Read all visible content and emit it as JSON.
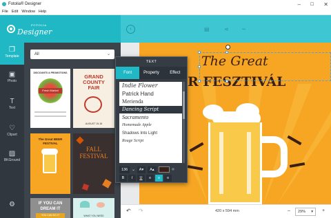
{
  "window": {
    "title": "Fotolia® Designer",
    "controls": [
      "–",
      "☐",
      "✕"
    ]
  },
  "menu": [
    "File",
    "Edit",
    "Window",
    "Help"
  ],
  "logo": {
    "small": "FOTOLIA",
    "name": "Designer"
  },
  "header": {
    "back_icon": "arrow-left-icon",
    "icons": [
      "save-icon",
      "share-icon",
      "more-icon"
    ],
    "more_label": "•••"
  },
  "rail": [
    {
      "label": "Template",
      "icon": "template-icon",
      "glyph": "❒"
    },
    {
      "label": "Photo",
      "icon": "photo-icon",
      "glyph": "▣"
    },
    {
      "label": "Text",
      "icon": "text-icon",
      "glyph": "T"
    },
    {
      "label": "Clipart",
      "icon": "heart-icon",
      "glyph": "♡"
    },
    {
      "label": "BKGround",
      "icon": "background-icon",
      "glyph": "▨"
    },
    {
      "label": "",
      "icon": "settings-icon",
      "glyph": "⚙"
    }
  ],
  "templates": {
    "filter_value": "All",
    "cards": [
      {
        "title": "DISCOUNTS & PROMOTIONS",
        "subtitle": "Fresh Market"
      },
      {
        "title": "GRAND COUNTY FAIR",
        "subtitle": "AUGUST 15-16"
      },
      {
        "title": "The Great BEER FESTIVAL",
        "subtitle": ""
      },
      {
        "title": "FALL FESTIVAL",
        "subtitle": ""
      },
      {
        "title": "IF YOU CAN DREAM IT",
        "subtitle": "YOU CAN DO IT"
      },
      {
        "title": "",
        "subtitle": "WHAT YOU NEED"
      }
    ]
  },
  "text_panel": {
    "title": "TEXT",
    "tabs": [
      "Font",
      "Property",
      "Effect"
    ],
    "active_tab": "Font",
    "fonts": [
      "Indie Flower",
      "Patrick Hand",
      "Merienda",
      "Dancing Script",
      "Sacramento",
      "Homemade Apple",
      "Shadows Into Light",
      "Rouge Script"
    ],
    "selected_font": "Dancing Script",
    "size": "136",
    "size_down": "A▾",
    "size_up": "A▴",
    "color": "#3a1f17",
    "style_buttons": [
      "B",
      "I",
      "U",
      "≡",
      "≡",
      "≡"
    ]
  },
  "canvas": {
    "headline_script": "The Great",
    "headline_bold": "R FESZTIVÁL",
    "background_color": "#f6a623"
  },
  "bottom": {
    "undo_icon": "undo-icon",
    "redo_icon": "redo-icon",
    "dimensions": "420 x 594 mm",
    "zoom_out": "–",
    "zoom_value": "29%",
    "zoom_in": "+"
  }
}
